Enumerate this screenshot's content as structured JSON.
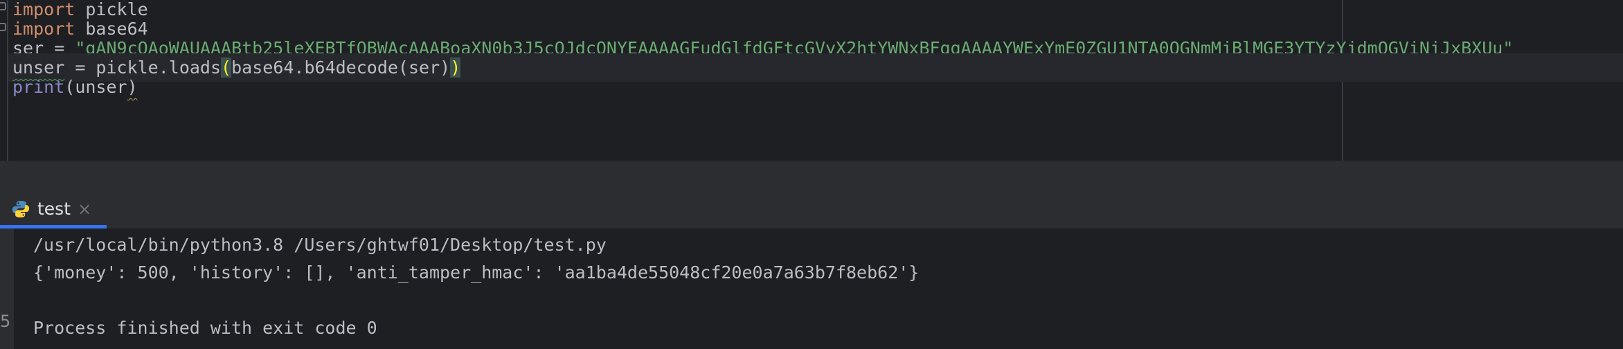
{
  "editor": {
    "lines": [
      {
        "kw": "import",
        "rest": " pickle"
      },
      {
        "kw": "import",
        "rest": " base64"
      },
      {
        "var": "ser",
        "op": " = ",
        "string": "\"gAN9cQAoWAUAAABtb25leXEBTfQBWAcAAABoaXN0b3J5cQJdcQNYEAAAAGFudGlfdGFtcGVyX2htYWNxBFggAAAAYWExYmE0ZGU1NTA0OGNmMjBlMGE3YTYzYjdmOGViNjJxBXUu\""
      },
      {
        "var": "unser",
        "op": " = ",
        "call": "pickle.loads",
        "open": "(",
        "inner": "base64.b64decode(ser)",
        "close": ")"
      },
      {
        "builtin": "print",
        "open": "(",
        "arg": "unser",
        "close": ")"
      }
    ]
  },
  "run_panel": {
    "tab_label": "test",
    "tab_close": "×",
    "gutter_mark": "5",
    "output": [
      "/usr/local/bin/python3.8 /Users/ghtwf01/Desktop/test.py",
      "{'money': 500, 'history': [], 'anti_tamper_hmac': 'aa1ba4de55048cf20e0a7a63b7f8eb62'}",
      "",
      "Process finished with exit code 0"
    ]
  },
  "colors": {
    "editor_bg": "#1e1f22",
    "keyword": "#cf8e6d",
    "string": "#6aab73",
    "builtin": "#8888c6",
    "tab_accent": "#3574f0"
  },
  "icons": {
    "run_tab_icon": "python-icon",
    "close": "close-icon"
  }
}
